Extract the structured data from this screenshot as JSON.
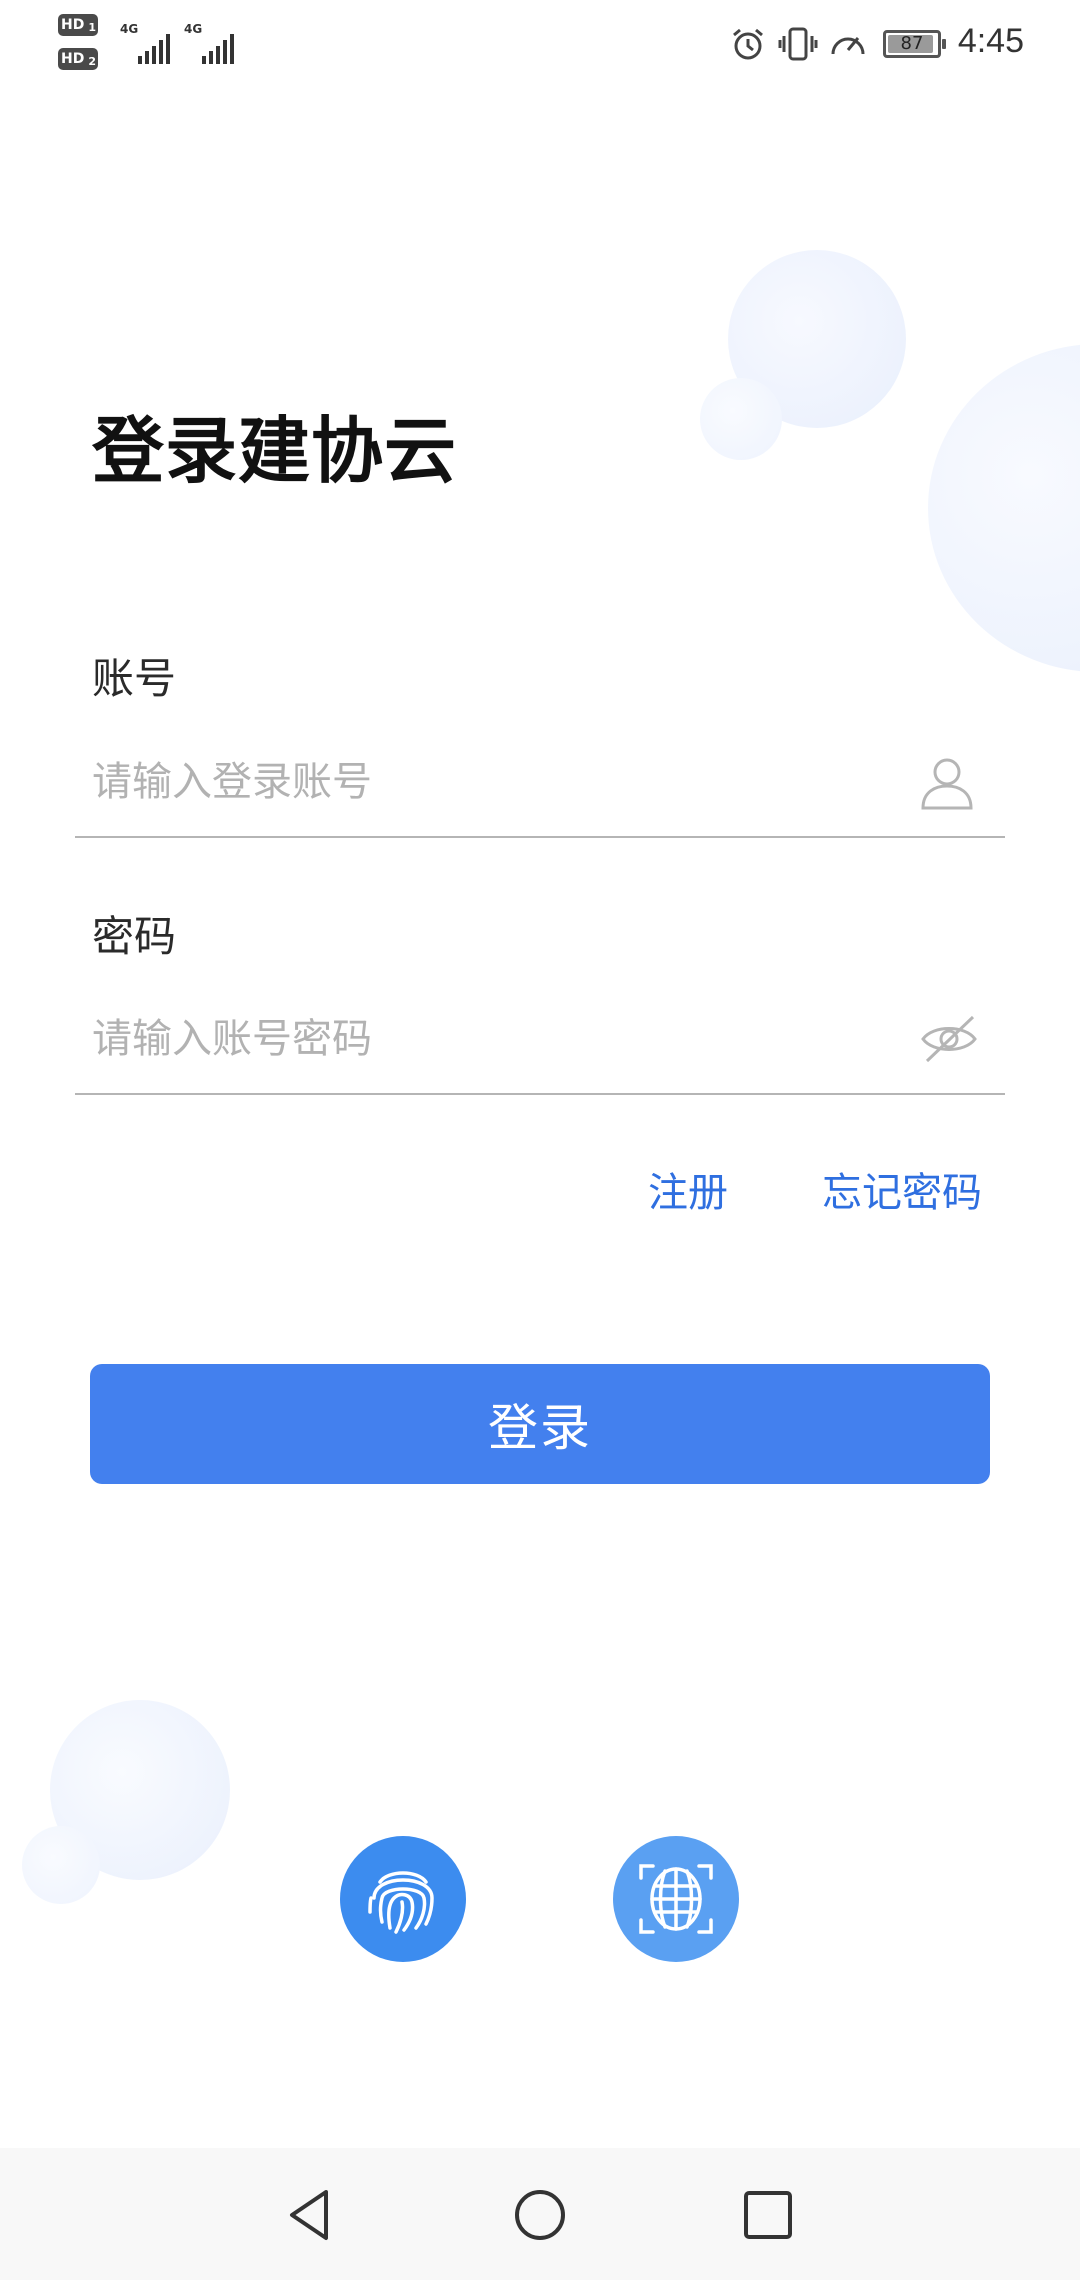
{
  "status_bar": {
    "sim1_label": "HD",
    "sim1_index": "1",
    "sim2_label": "HD",
    "sim2_index": "2",
    "network1": "4G",
    "network2": "4G",
    "battery_percent": "87",
    "time": "4:45",
    "icons": [
      "alarm-icon",
      "vibrate-icon",
      "speed-icon",
      "battery-icon"
    ]
  },
  "title": "登录建协云",
  "account": {
    "label": "账号",
    "placeholder": "请输入登录账号",
    "value": "",
    "icon": "user-icon"
  },
  "password": {
    "label": "密码",
    "placeholder": "请输入账号密码",
    "value": "",
    "icon": "eye-off-icon"
  },
  "links": {
    "register": "注册",
    "forgot_password": "忘记密码"
  },
  "login_button": "登录",
  "biometrics": [
    "fingerprint-icon",
    "face-scan-icon"
  ],
  "nav_bar": [
    "back-icon",
    "home-icon",
    "recent-apps-icon"
  ],
  "colors": {
    "accent": "#4380ee",
    "link": "#2f6fe0",
    "fingerprint_bg": "#3c8cef",
    "face_bg": "#5aa0f2"
  }
}
